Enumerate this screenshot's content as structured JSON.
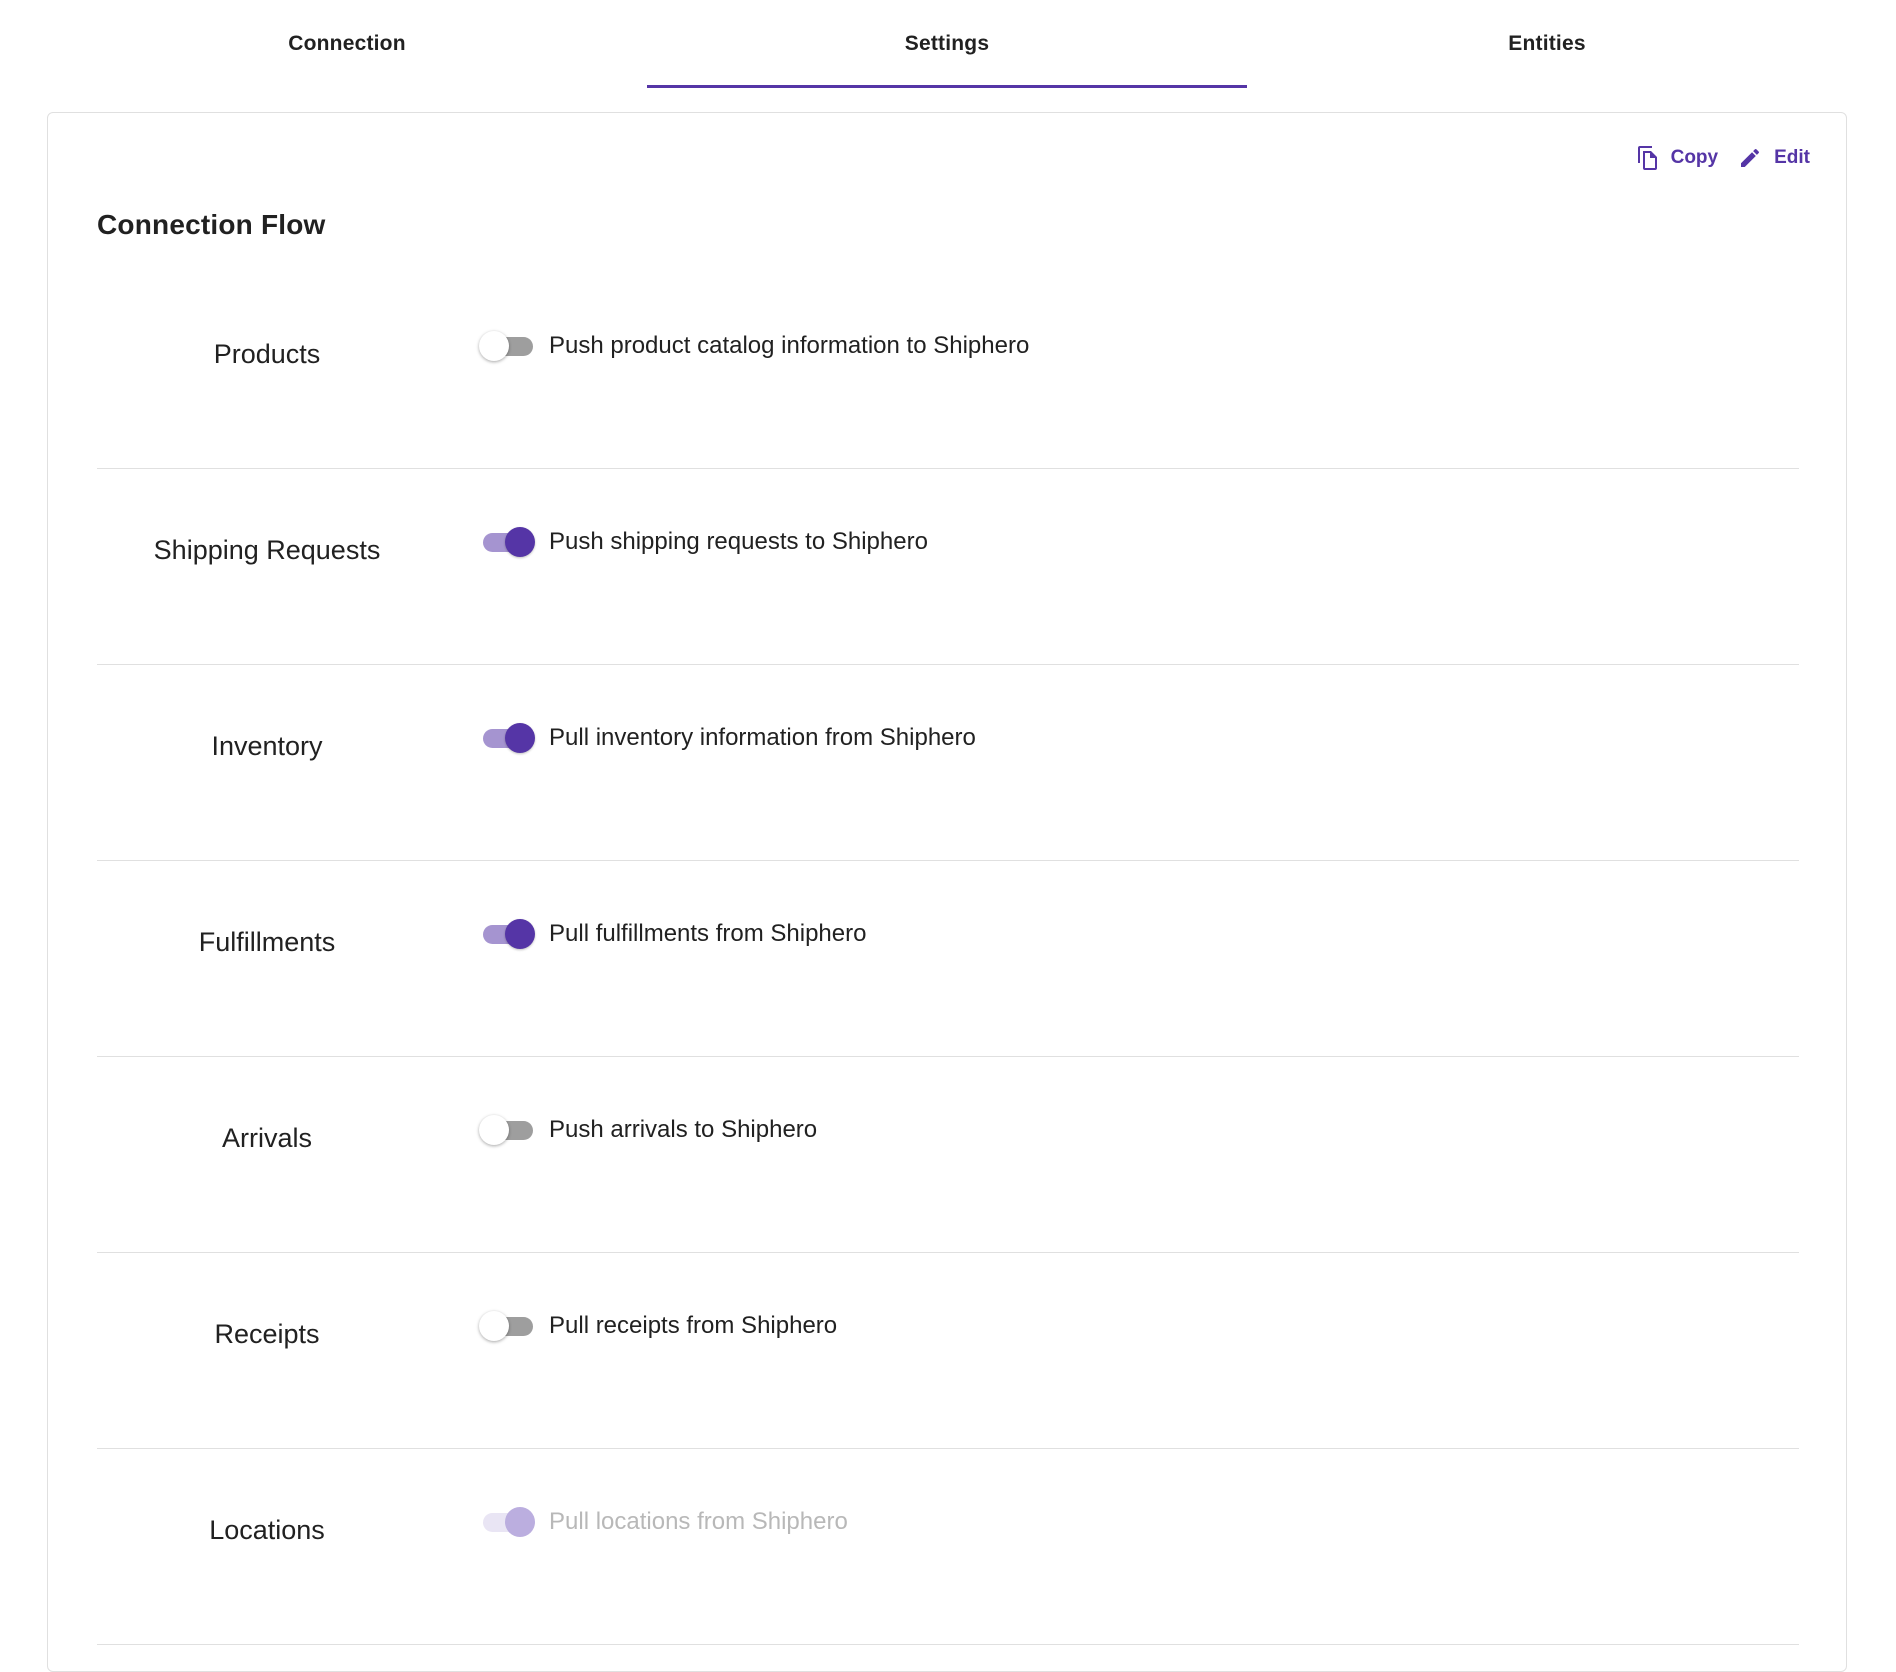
{
  "tabs": [
    {
      "label": "Connection",
      "active": false
    },
    {
      "label": "Settings",
      "active": true
    },
    {
      "label": "Entities",
      "active": false
    }
  ],
  "actions": {
    "copy_label": "Copy",
    "edit_label": "Edit"
  },
  "section": {
    "title": "Connection Flow"
  },
  "flows": [
    {
      "label": "Products",
      "description": "Push product catalog information to Shiphero",
      "enabled": false,
      "disabled": false
    },
    {
      "label": "Shipping Requests",
      "description": "Push shipping requests to Shiphero",
      "enabled": true,
      "disabled": false
    },
    {
      "label": "Inventory",
      "description": "Pull inventory information from Shiphero",
      "enabled": true,
      "disabled": false
    },
    {
      "label": "Fulfillments",
      "description": "Pull fulfillments from Shiphero",
      "enabled": true,
      "disabled": false
    },
    {
      "label": "Arrivals",
      "description": "Push arrivals to Shiphero",
      "enabled": false,
      "disabled": false
    },
    {
      "label": "Receipts",
      "description": "Pull receipts from Shiphero",
      "enabled": false,
      "disabled": false
    },
    {
      "label": "Locations",
      "description": "Pull locations from Shiphero",
      "enabled": true,
      "disabled": true
    }
  ],
  "colors": {
    "accent": "#5535a6",
    "track_on": "#a594d0",
    "track_off": "#9e9e9e",
    "divider": "#e0e0e0"
  }
}
